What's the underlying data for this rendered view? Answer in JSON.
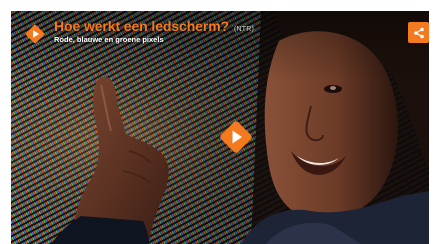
{
  "video": {
    "title": "Hoe werkt een ledscherm?",
    "tag": "(NTR)",
    "subtitle": "Rode, blauwe en groene pixels"
  },
  "icons": {
    "brand": "npo-diamond-play-icon",
    "share": "share-icon",
    "play": "play-icon"
  },
  "colors": {
    "accent": "#f47a1f",
    "title_text": "#f47a1f",
    "subtitle_text": "#ffffff"
  }
}
